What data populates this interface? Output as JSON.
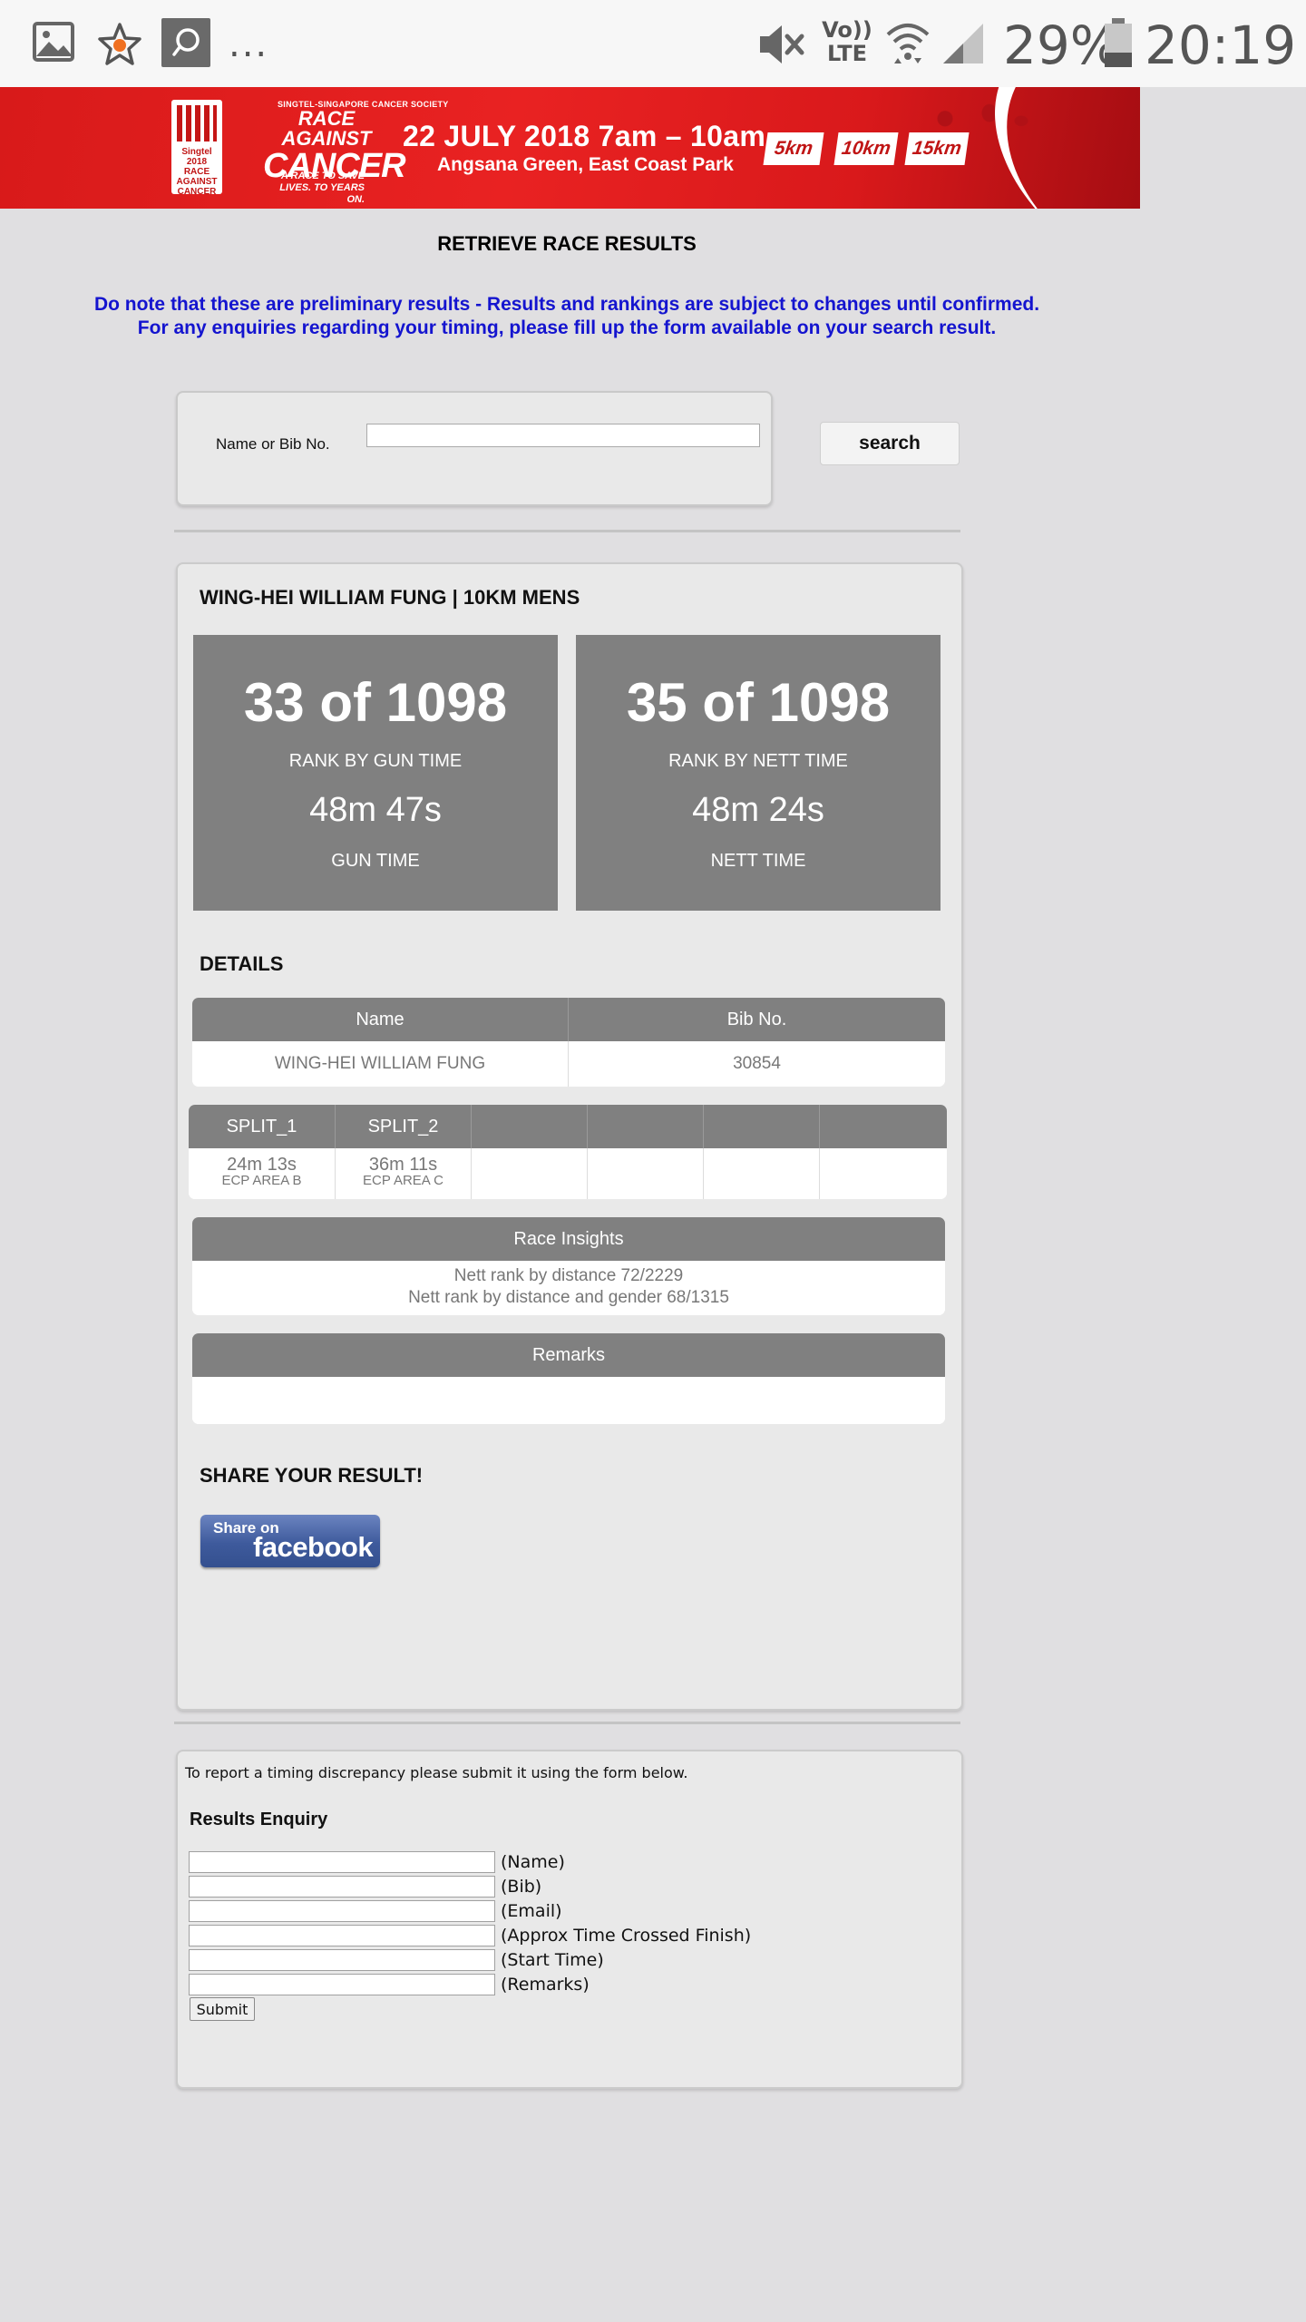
{
  "status_bar": {
    "icons": [
      "gallery-icon",
      "star-icon",
      "chat-icon",
      "more-icon",
      "mute-icon",
      "volte-icon",
      "wifi-icon",
      "signal-icon",
      "battery-icon"
    ],
    "more": "...",
    "volte_top": "Vo))",
    "volte_bottom": "LTE",
    "battery": "29%",
    "time": "20:19"
  },
  "banner": {
    "logo_text": "Singtel 2018 RACE AGAINST CANCER",
    "org": "SINGTEL-SINGAPORE CANCER SOCIETY",
    "title_line1": "RACE AGAINST",
    "title_line2": "CANCER",
    "tagline": "A RACE TO SAVE LIVES. TO YEARS ON.",
    "date": "22 JULY 2018  7am – 10am",
    "venue": "Angsana Green, East Coast Park",
    "distances": [
      "5km",
      "10km",
      "15km"
    ]
  },
  "page": {
    "title": "RETRIEVE RACE RESULTS",
    "notice_line1": "Do note that these are preliminary results - Results and rankings are subject to changes until confirmed.",
    "notice_line2": "For any enquiries regarding your timing, please fill up the form available on your search result."
  },
  "search": {
    "label": "Name or Bib No.",
    "value": "",
    "button": "search"
  },
  "result": {
    "heading": "WING-HEI WILLIAM FUNG | 10KM MENS",
    "gun": {
      "rank": "33 of 1098",
      "rank_label": "RANK BY GUN TIME",
      "time": "48m 47s",
      "time_label": "GUN TIME"
    },
    "nett": {
      "rank": "35 of 1098",
      "rank_label": "RANK BY NETT TIME",
      "time": "48m 24s",
      "time_label": "NETT TIME"
    },
    "details_heading": "DETAILS",
    "details": {
      "headers": [
        "Name",
        "Bib No."
      ],
      "values": [
        "WING-HEI WILLIAM FUNG",
        "30854"
      ]
    },
    "splits": {
      "headers": [
        "SPLIT_1",
        "SPLIT_2"
      ],
      "times": [
        "24m 13s",
        "36m 11s"
      ],
      "locations": [
        "ECP AREA B",
        "ECP AREA C"
      ]
    },
    "insights": {
      "header": "Race Insights",
      "line1": "Nett rank by distance 72/2229",
      "line2": "Nett rank by distance and gender 68/1315"
    },
    "remarks": {
      "header": "Remarks",
      "value": ""
    },
    "share_heading": "SHARE YOUR RESULT!",
    "facebook_line1": "Share on",
    "facebook_line2": "facebook"
  },
  "enquiry": {
    "note": "To report a timing discrepancy please submit it using the form below.",
    "title": "Results Enquiry",
    "fields": [
      "(Name)",
      "(Bib)",
      "(Email)",
      "(Approx Time Crossed Finish)",
      "(Start Time)",
      "(Remarks)"
    ],
    "submit": "Submit"
  }
}
